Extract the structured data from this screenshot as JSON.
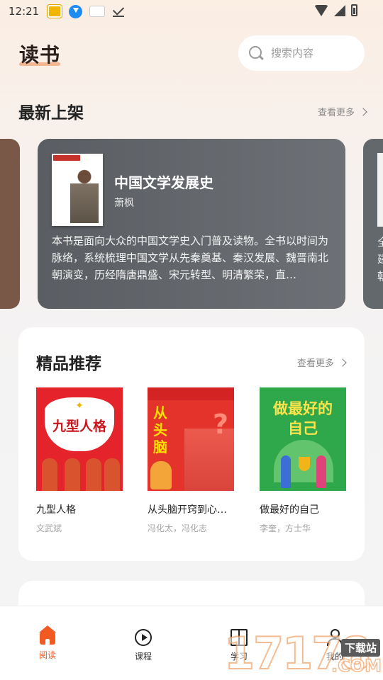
{
  "status_bar": {
    "time": "12:21"
  },
  "header": {
    "title": "读书"
  },
  "search": {
    "placeholder": "搜索内容"
  },
  "new_arrivals": {
    "title": "最新上架",
    "more_label": "查看更多",
    "featured": {
      "title": "中国文学发展史",
      "author": "萧枫",
      "description": "本书是面向大众的中国文学史入门普及读物。全书以时间为脉络，系统梳理中国文学从先秦奠基、秦汉发展、魏晋南北朝演变，历经隋唐鼎盛、宋元转型、明清繁荣，直…"
    },
    "next_peek_text": "全\n建\n朝"
  },
  "recommended": {
    "title": "精品推荐",
    "more_label": "查看更多",
    "books": [
      {
        "name": "九型人格",
        "author": "文武斌",
        "cover_text": "九型人格"
      },
      {
        "name": "从头脑开窍到心灵…",
        "author": "冯化太，冯化志",
        "cover_lines": [
          "从",
          "头",
          "脑"
        ]
      },
      {
        "name": "做最好的自己",
        "author": "李奎，方士华",
        "cover_text": "做最好的\n自己"
      }
    ]
  },
  "bottom_nav": {
    "items": [
      {
        "label": "阅读",
        "icon": "home-icon",
        "active": true
      },
      {
        "label": "课程",
        "icon": "play-circle-icon",
        "active": false
      },
      {
        "label": "学习",
        "icon": "book-icon",
        "active": false
      },
      {
        "label": "我的",
        "icon": "user-icon",
        "active": false
      }
    ]
  },
  "watermark": {
    "digits": "17178",
    "tag": "下载站",
    "suffix": ".COM"
  },
  "colors": {
    "accent": "#f25a22",
    "card_gray": "#63676c"
  }
}
